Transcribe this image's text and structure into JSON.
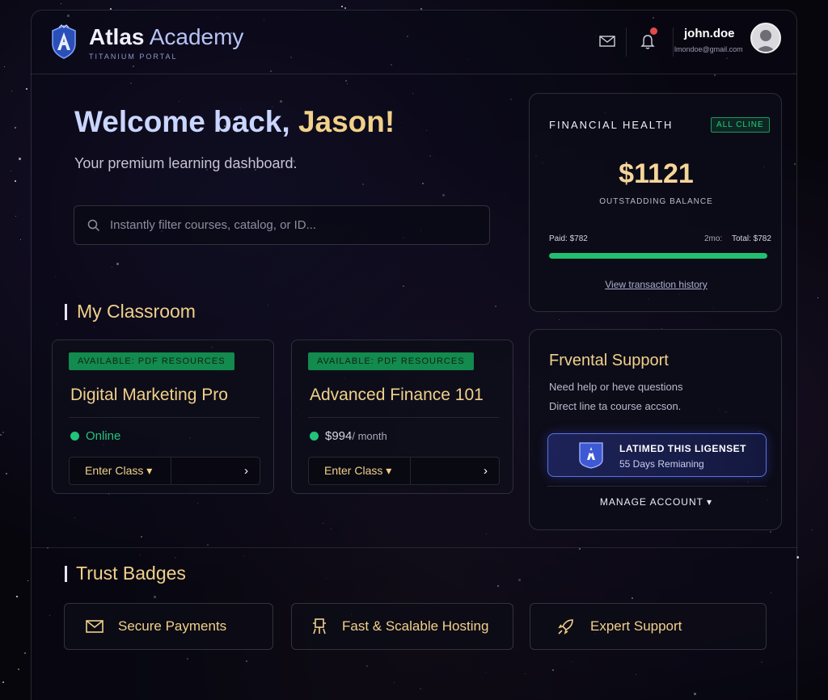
{
  "header": {
    "brand_bold": "Atlas",
    "brand_light": " Academy",
    "brand_subtitle": "TITANIUM PORTAL",
    "username": "john.doe",
    "email": "lmondoe@gmail.com"
  },
  "hero": {
    "greeting": "Welcome back, ",
    "name": "Jason!",
    "subtitle": "Your premium learning dashboard."
  },
  "search": {
    "placeholder": "Instantly filter courses, catalog, or ID..."
  },
  "classroom": {
    "title": "My Classroom",
    "courses": [
      {
        "badge": "AVAILABLE: PDF RESOURCES",
        "title": "Digital Marketing Pro",
        "status": "Online",
        "status_color": "#22c47a",
        "button": "Enter Class ▾"
      },
      {
        "badge": "AVAILABLE: PDF RESOURCES",
        "title": "Advanced Finance 101",
        "price": "$994",
        "per": " / month",
        "status_color": "#22c47a",
        "button": "Enter Class ▾"
      }
    ]
  },
  "financial": {
    "title": "FINANCIAL HEALTH",
    "status": "ALL CLINE",
    "amount": "$1121",
    "amount_label": "OUTSTADDING BALANCE",
    "paid": "Paid: $782",
    "mid": "2mo:",
    "total": "Total: $782",
    "progress": 1.0,
    "link": "View transaction history"
  },
  "support": {
    "title": "Frvental Support",
    "line1": "Need help or heve questions",
    "line2": "Direct line ta course accson.",
    "license_title": "LATIMED THIS LIGENSET",
    "license_sub": "55 Days Remianing",
    "manage": "MANAGE ACCOUNT ▾"
  },
  "trust": {
    "title": "Trust Badges",
    "badges": [
      {
        "label": "Secure Payments",
        "icon": "envelope-icon"
      },
      {
        "label": "Fast & Scalable Hosting",
        "icon": "server-icon"
      },
      {
        "label": "Expert Support",
        "icon": "rocket-icon"
      }
    ]
  },
  "colors": {
    "accent_gold": "#f1d08a",
    "accent_green": "#22c47a",
    "accent_blue": "#5b70e2"
  }
}
